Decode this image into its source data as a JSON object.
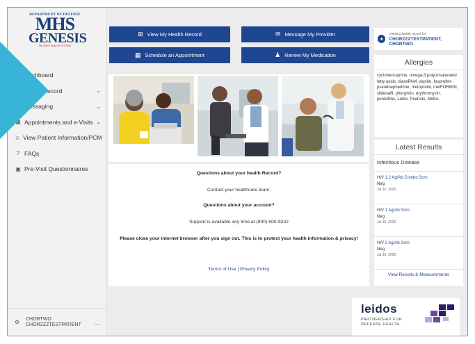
{
  "sidebar": {
    "logo": {
      "dept": "DEPARTMENT OF DEFENSE",
      "mhs": "MHS",
      "genesis": "GENESIS",
      "tagline": "MILITARY HEALTH SYSTEM"
    },
    "items": [
      {
        "label": "Dashboard",
        "icon": "home-icon",
        "chevron": false
      },
      {
        "label": "Health Record",
        "icon": "file-icon",
        "chevron": true
      },
      {
        "label": "Messaging",
        "icon": "envelope-icon",
        "chevron": true
      },
      {
        "label": "Appointments and e-Visits",
        "icon": "calendar-icon",
        "chevron": true
      },
      {
        "label": "View Patient Information/PCM",
        "icon": "user-icon",
        "chevron": false
      },
      {
        "label": "FAQs",
        "icon": "question-icon",
        "chevron": false
      },
      {
        "label": "Pre-Visit Questionnaires",
        "icon": "clipboard-icon",
        "chevron": false
      }
    ],
    "user": {
      "line1": "CHORTWO",
      "line2": "CHORZZZTESTPATIENT",
      "more": "..."
    }
  },
  "actions": {
    "view_record": "View My Health Record",
    "message_provider": "Message My Provider",
    "schedule": "Schedule an Appointment",
    "renew": "Renew My Medication"
  },
  "info": {
    "q1": "Questions about your health Record?",
    "a1": "Contact your healthcare team.",
    "q2": "Questions about your account?",
    "a2": "Support is available any time at (800) 600-9332",
    "notice": "Please close your internet browser after you sign out. This is to protect your health information & privacy!",
    "footer_links": "Terms of Use | Privacy Policy"
  },
  "patient": {
    "viewing": "Viewing health record for",
    "name": "CHORZZZTESTPATIENT, CHORTWO"
  },
  "allergies": {
    "title": "Allergies",
    "text": "cyclobenzaprine, omega-3 polyunsaturated fatty acids, diazePAM, aspirin, ibuprofen-pseudoephedrine, metoprolol, metFORMIN, sildenafil, phenytoin, erythromycin, penicillins, Latex, Peanuts, Mobic"
  },
  "results": {
    "title": "Latest Results",
    "section": "Infectious Disease",
    "items": [
      {
        "name": "HIV 1,2 Ag/Ab Combo Scrn",
        "value": "Neg",
        "date": "Jul 16, 2020"
      },
      {
        "name": "HIV 1 Ag/Ab Scrn",
        "value": "Neg",
        "date": "Jul 16, 2020"
      },
      {
        "name": "HIV 2 Ag/Ab Scrn",
        "value": "Neg",
        "date": "Jul 16, 2020"
      }
    ],
    "link": "View Results & Measurements"
  },
  "partner": {
    "word": "leidos",
    "line1": "PARTNERSHIP FOR",
    "line2": "DEFENSE HEALTH"
  },
  "colors": {
    "primary": "#1f4690",
    "overlay": "#37b4d8",
    "background": "#ececec"
  }
}
